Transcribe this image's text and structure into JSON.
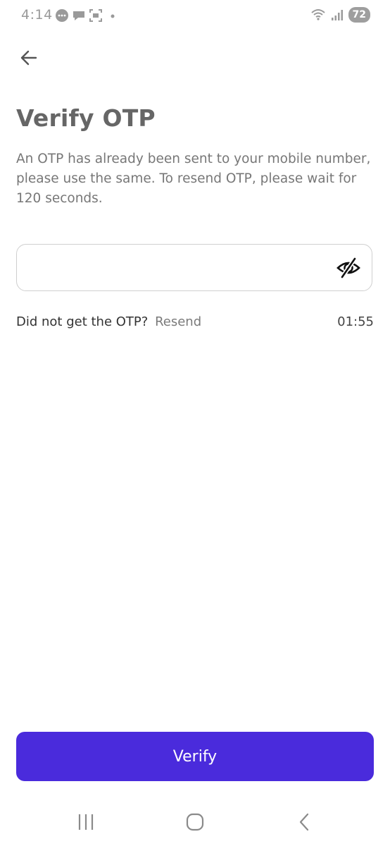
{
  "status_bar": {
    "time": "4:14",
    "battery": "72",
    "icons": [
      "chat-bubble-icon",
      "message-icon",
      "screenshot-icon",
      "dot-icon",
      "wifi-icon",
      "signal-icon",
      "battery-icon"
    ]
  },
  "header": {
    "back_icon": "arrow-left-icon"
  },
  "page": {
    "title": "Verify OTP",
    "subtitle": "An OTP has already been sent to your mobile number, please use the same. To resend OTP, please wait for 120 seconds."
  },
  "otp_input": {
    "value": "",
    "placeholder": "",
    "toggle_icon": "eye-slash-icon"
  },
  "resend": {
    "prompt": "Did not get the OTP?",
    "link_label": "Resend",
    "timer": "01:55"
  },
  "actions": {
    "verify_label": "Verify"
  },
  "colors": {
    "primary": "#4a2bdc",
    "title": "#666666",
    "body_text": "#777777",
    "border": "#cfcfcf"
  },
  "nav_bar": {
    "icons": [
      "recent-apps-icon",
      "home-icon",
      "back-icon"
    ]
  }
}
